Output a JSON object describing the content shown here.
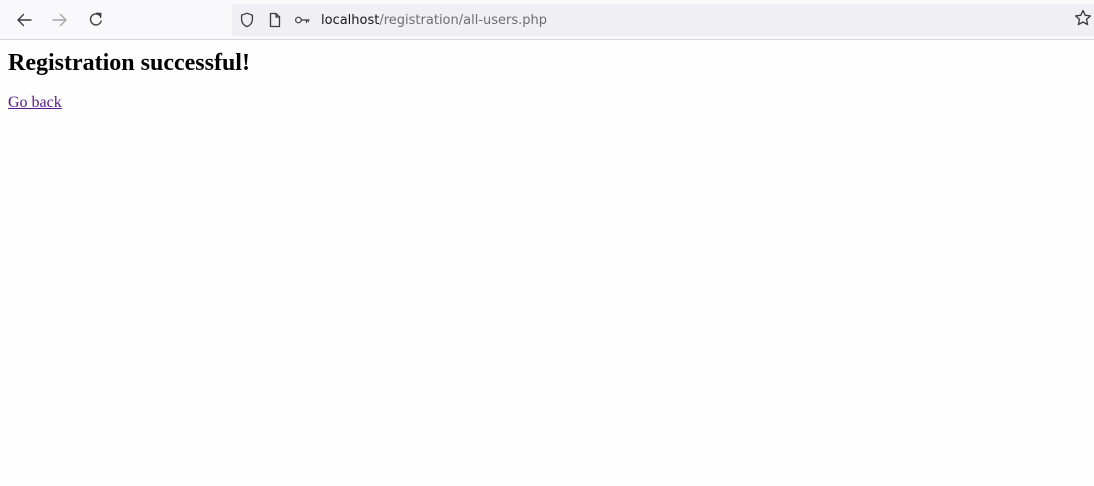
{
  "browser": {
    "url_host": "localhost",
    "url_path": "/registration/all-users.php",
    "icons": {
      "back": "arrow-left-icon",
      "forward": "arrow-right-icon",
      "reload": "reload-icon",
      "tracking": "shield-icon",
      "page": "page-icon",
      "key": "key-icon",
      "bookmark": "star-icon"
    }
  },
  "page": {
    "heading": "Registration successful!",
    "back_link": "Go back",
    "link_color": "#551a8b"
  }
}
